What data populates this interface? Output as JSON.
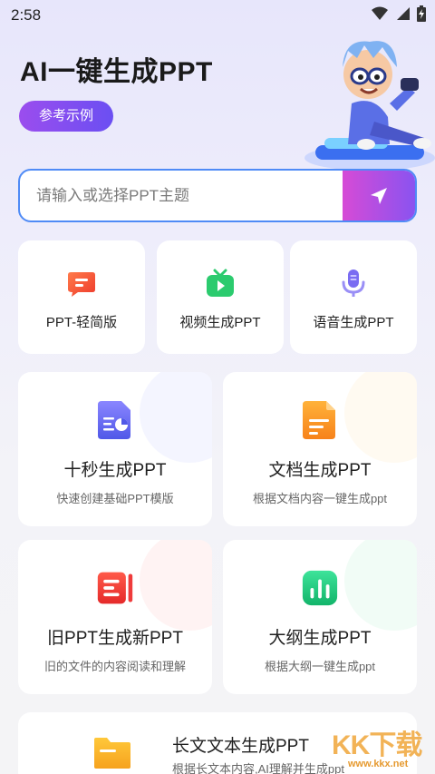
{
  "status_bar": {
    "time": "2:58"
  },
  "header": {
    "title": "AI一键生成PPT",
    "example_button": "参考示例"
  },
  "search": {
    "placeholder": "请输入或选择PPT主题"
  },
  "quick_tools": [
    {
      "label": "PPT-轻简版",
      "icon": "message-square-icon",
      "color": "#f2553a"
    },
    {
      "label": "视频生成PPT",
      "icon": "tv-play-icon",
      "color": "#2bcb6e"
    },
    {
      "label": "语音生成PPT",
      "icon": "microphone-icon",
      "color": "#7a6cf2"
    }
  ],
  "feature_cards": [
    {
      "title": "十秒生成PPT",
      "subtitle": "快速创建基础PPT模版",
      "icon": "document-chart-icon",
      "color": "#5c63ef"
    },
    {
      "title": "文档生成PPT",
      "subtitle": "根据文档内容一键生成ppt",
      "icon": "document-text-icon",
      "color": "#f79a1e"
    },
    {
      "title": "旧PPT生成新PPT",
      "subtitle": "旧的文件的内容阅读和理解",
      "icon": "list-document-icon",
      "color": "#ef3b3b"
    },
    {
      "title": "大纲生成PPT",
      "subtitle": "根据大纲一键生成ppt",
      "icon": "bar-chart-icon",
      "color": "#1cc77e"
    }
  ],
  "long_text_card": {
    "title": "长文文本生成PPT",
    "subtitle": "根据长文本内容,AI理解并生成ppt",
    "icon": "folder-icon",
    "color": "#f6b51e"
  },
  "watermark": {
    "logo": "KK下载",
    "url": "www.kkx.net"
  }
}
